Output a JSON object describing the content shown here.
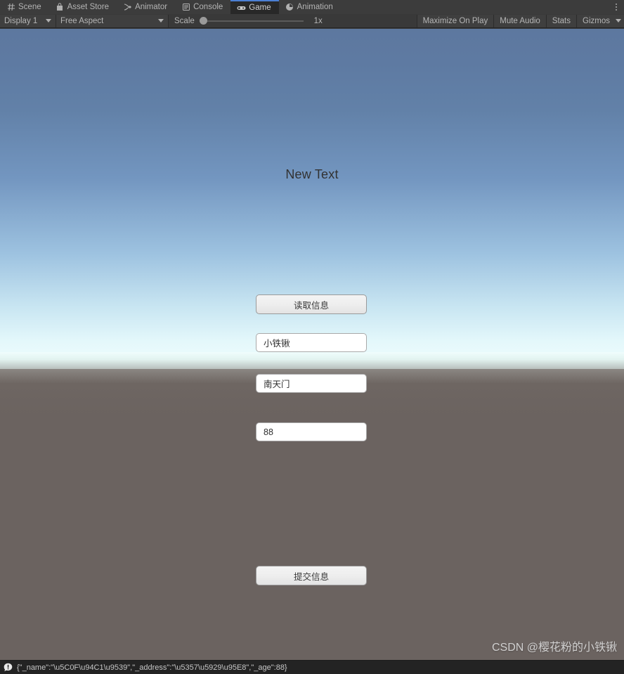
{
  "tabbar": {
    "tabs": [
      {
        "label": "Scene",
        "icon": "grid-icon",
        "active": false
      },
      {
        "label": "Asset Store",
        "icon": "bag-icon",
        "active": false
      },
      {
        "label": "Animator",
        "icon": "animator-icon",
        "active": false
      },
      {
        "label": "Console",
        "icon": "console-icon",
        "active": false
      },
      {
        "label": "Game",
        "icon": "gamepad-icon",
        "active": true
      },
      {
        "label": "Animation",
        "icon": "clock-icon",
        "active": false
      }
    ],
    "overflow_menu": "kebab-icon",
    "active_tab_accent": "#4b7fd4"
  },
  "toolbar": {
    "display_select": "Display 1",
    "aspect_select": "Free Aspect",
    "scale_label": "Scale",
    "scale_value": "1x",
    "scale_slider_percent": 0,
    "maximize_on_play": "Maximize On Play",
    "mute_audio": "Mute Audio",
    "stats": "Stats",
    "gizmos": "Gizmos"
  },
  "game": {
    "heading": "New Text",
    "read_button": "读取信息",
    "submit_button": "提交信息",
    "fields": [
      {
        "name": "name-field",
        "value": "小铁锹"
      },
      {
        "name": "address-field",
        "value": "南天门"
      },
      {
        "name": "age-field",
        "value": "88"
      }
    ],
    "watermark": "CSDN @樱花粉的小铁锹",
    "sky_top_color": "#5d789f",
    "sky_horizon_color": "#f0fdfd",
    "ground_color": "#6b6360"
  },
  "statusbar": {
    "icon": "error-icon",
    "message": "{\"_name\":\"\\u5C0F\\u94C1\\u9539\",\"_address\":\"\\u5357\\u5929\\u95E8\",\"_age\":88}"
  }
}
